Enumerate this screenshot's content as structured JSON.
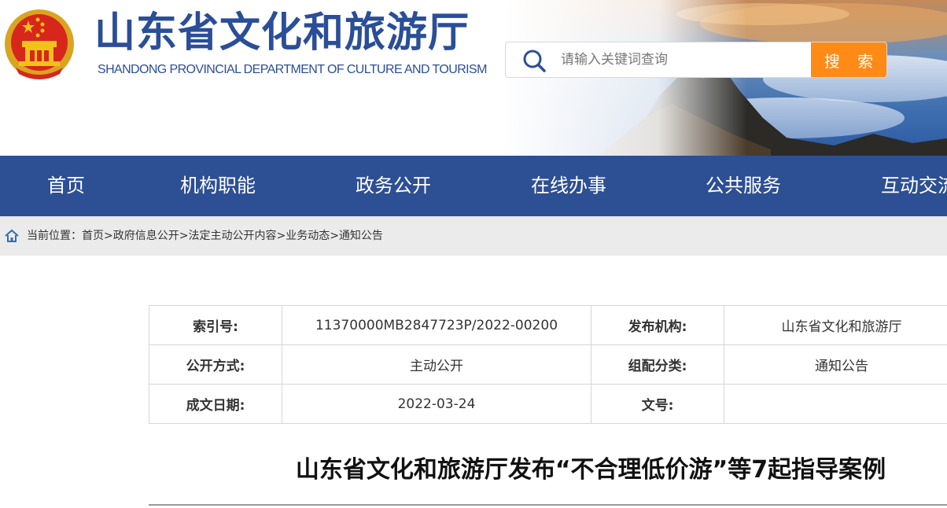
{
  "header": {
    "site_title": "山东省文化和旅游厅",
    "site_subtitle": "SHANDONG PROVINCIAL DEPARTMENT OF CULTURE AND TOURISM",
    "search": {
      "placeholder": "请输入关键词查询",
      "button_label": "搜 索"
    }
  },
  "nav": {
    "items": [
      "首页",
      "机构职能",
      "政务公开",
      "在线办事",
      "公共服务",
      "互动交流"
    ]
  },
  "breadcrumb": {
    "prefix": "当前位置：",
    "items": [
      "首页",
      "政府信息公开",
      "法定主动公开内容",
      "业务动态",
      "通知公告"
    ],
    "separator": ">"
  },
  "meta": {
    "index_label": "索引号:",
    "index_value": "11370000MB2847723P/2022-00200",
    "publisher_label": "发布机构:",
    "publisher_value": "山东省文化和旅游厅",
    "disclosure_label": "公开方式:",
    "disclosure_value": "主动公开",
    "category_label": "组配分类:",
    "category_value": "通知公告",
    "date_label": "成文日期:",
    "date_value": "2022-03-24",
    "docno_label": "文号:",
    "docno_value": ""
  },
  "article": {
    "title": "山东省文化和旅游厅发布“不合理低价游”等7起指导案例"
  },
  "colors": {
    "brand_blue": "#2d4f93",
    "title_blue": "#2a4e97",
    "search_orange": "#ff8a15",
    "breadcrumb_bg": "#ebebeb"
  }
}
